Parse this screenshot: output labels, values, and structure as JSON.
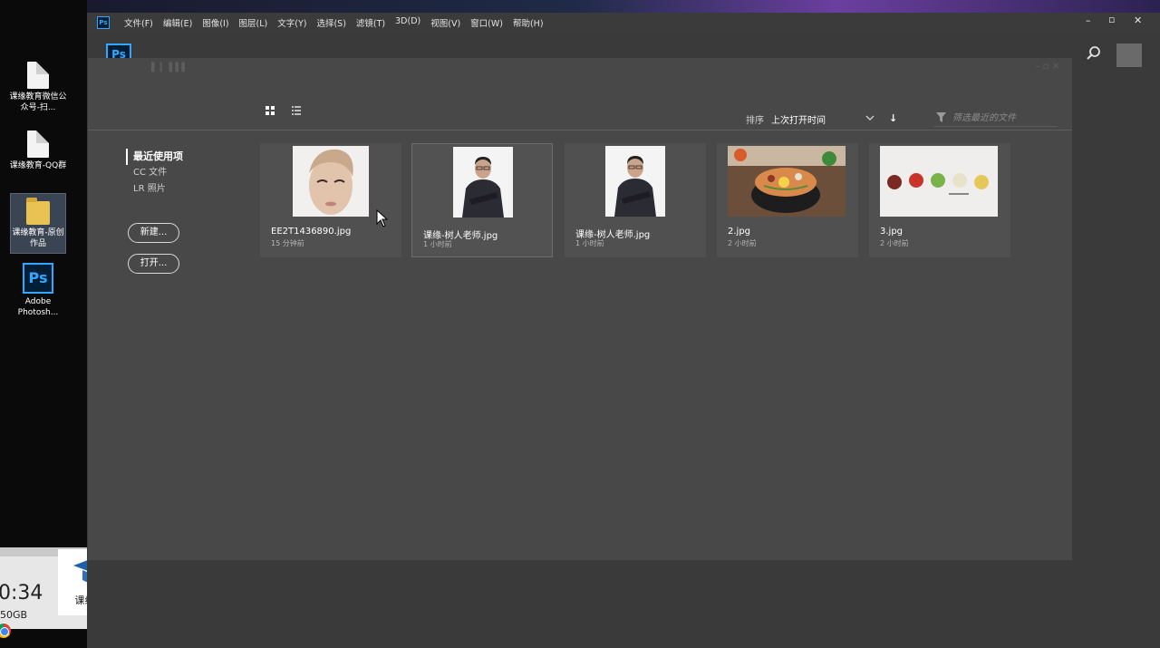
{
  "desktop": {
    "icons": [
      {
        "label": "课缘教育微信公众号-扫..."
      },
      {
        "label": "课缘教育-QQ群"
      },
      {
        "label": "课缘教育-原创作品"
      },
      {
        "label": "Adobe Photosh..."
      }
    ]
  },
  "widget": {
    "time": "0:34",
    "storage": "50GB"
  },
  "watermark": {
    "name": "课缘教育"
  },
  "menubar": {
    "items": [
      "文件(F)",
      "编辑(E)",
      "图像(I)",
      "图层(L)",
      "文字(Y)",
      "选择(S)",
      "滤镜(T)",
      "3D(D)",
      "视图(V)",
      "窗口(W)",
      "帮助(H)"
    ]
  },
  "app": {
    "logo": "Ps"
  },
  "nav": {
    "recent": "最近使用项",
    "cc_files": "CC 文件",
    "lr_photos": "LR 照片",
    "new_button": "新建...",
    "open_button": "打开..."
  },
  "sort": {
    "label": "排序",
    "value": "上次打开时间"
  },
  "filter": {
    "placeholder": "筛选最近的文件"
  },
  "files": [
    {
      "name": "EE2T1436890.jpg",
      "time": "15 分钟前"
    },
    {
      "name": "课缘-树人老师.jpg",
      "time": "1 小时前"
    },
    {
      "name": "课缘-树人老师.jpg",
      "time": "1 小时前"
    },
    {
      "name": "2.jpg",
      "time": "2 小时前"
    },
    {
      "name": "3.jpg",
      "time": "2 小时前"
    }
  ],
  "colors": {
    "accent": "#31a8ff",
    "panel": "#484848",
    "card": "#505050"
  }
}
